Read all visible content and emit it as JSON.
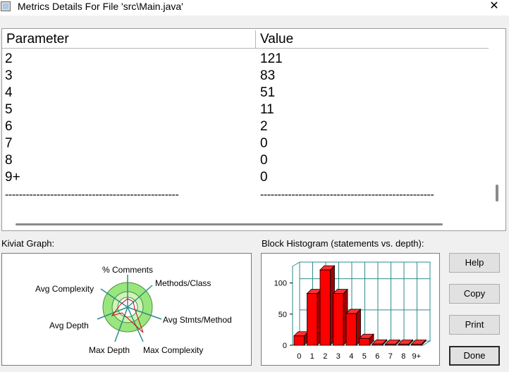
{
  "window": {
    "title": "Metrics Details For File 'src\\Main.java'",
    "close_glyph": "✕"
  },
  "table": {
    "headers": [
      "Parameter",
      "Value"
    ],
    "rows": [
      [
        "2",
        "121"
      ],
      [
        "3",
        "83"
      ],
      [
        "4",
        "51"
      ],
      [
        "5",
        "11"
      ],
      [
        "6",
        "2"
      ],
      [
        "7",
        "0"
      ],
      [
        "8",
        "0"
      ],
      [
        "9+",
        "0"
      ]
    ],
    "separator_left": "--------------------------------------------------",
    "separator_right": "--------------------------------------------------"
  },
  "kiviat": {
    "label": "Kiviat Graph:",
    "axes": [
      "% Comments",
      "Methods/Class",
      "Avg Stmts/Method",
      "Max Complexity",
      "Max Depth",
      "Avg Depth",
      "Avg Complexity"
    ]
  },
  "histogram": {
    "label": "Block Histogram (statements vs. depth):"
  },
  "chart_data": {
    "type": "bar",
    "categories": [
      "0",
      "1",
      "2",
      "3",
      "4",
      "5",
      "6",
      "7",
      "8",
      "9+"
    ],
    "values": [
      15,
      83,
      121,
      83,
      51,
      11,
      2,
      0,
      0,
      0
    ],
    "title": "",
    "xlabel": "",
    "ylabel": "",
    "ylim": [
      0,
      120
    ],
    "yticks": [
      "0",
      "50",
      "100"
    ],
    "bar_color": "#ff0000",
    "grid": true
  },
  "buttons": {
    "help": "Help",
    "copy": "Copy",
    "print": "Print",
    "done": "Done"
  },
  "colors": {
    "ring_outer": "#99e67e",
    "ring_inner": "#cdf5b8",
    "axis": "#2e8b8b",
    "plot_line": "#d00000",
    "grid": "#2e8b8b"
  }
}
